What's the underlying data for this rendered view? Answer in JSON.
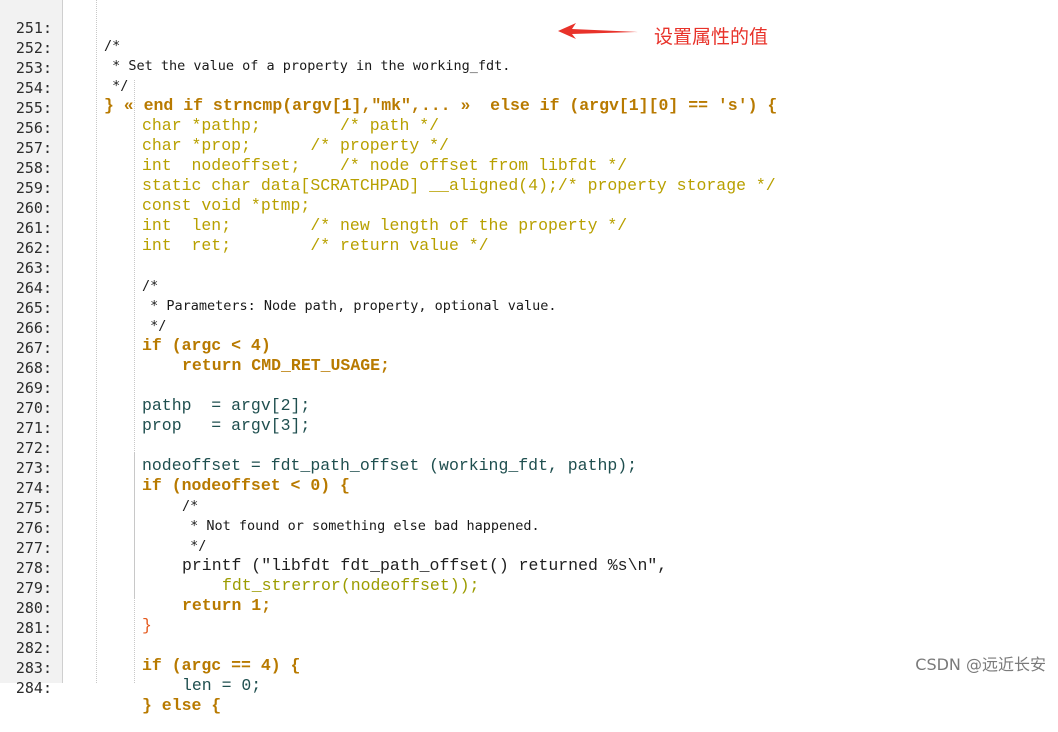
{
  "annotation": {
    "text": "设置属性的值",
    "arrow_icon": "red-arrow-icon",
    "color": "#e8322a"
  },
  "watermark": "CSDN @远近长安",
  "lines": [
    {
      "n": "251:",
      "t": "/*"
    },
    {
      "n": "252:",
      "t": " * Set the value of a property in the working_fdt."
    },
    {
      "n": "253:",
      "t": " */"
    },
    {
      "n": "254:",
      "t": "} « end if strncmp(argv[1],\"mk\",... »  else if (argv[1][0] == 's') {"
    },
    {
      "n": "255:",
      "t": "char *pathp;        /* path */"
    },
    {
      "n": "256:",
      "t": "char *prop;      /* property */"
    },
    {
      "n": "257:",
      "t": "int  nodeoffset;    /* node offset from libfdt */"
    },
    {
      "n": "258:",
      "t": "static char data[SCRATCHPAD] __aligned(4);/* property storage */"
    },
    {
      "n": "259:",
      "t": "const void *ptmp;"
    },
    {
      "n": "260:",
      "t": "int  len;        /* new length of the property */"
    },
    {
      "n": "261:",
      "t": "int  ret;        /* return value */"
    },
    {
      "n": "262:",
      "t": ""
    },
    {
      "n": "263:",
      "t": "/*"
    },
    {
      "n": "264:",
      "t": " * Parameters: Node path, property, optional value."
    },
    {
      "n": "265:",
      "t": " */"
    },
    {
      "n": "266:",
      "t": "if (argc < 4)"
    },
    {
      "n": "267:",
      "t": "return CMD_RET_USAGE;"
    },
    {
      "n": "268:",
      "t": ""
    },
    {
      "n": "269:",
      "t": "pathp  = argv[2];"
    },
    {
      "n": "270:",
      "t": "prop   = argv[3];"
    },
    {
      "n": "271:",
      "t": ""
    },
    {
      "n": "272:",
      "t": "nodeoffset = fdt_path_offset (working_fdt, pathp);"
    },
    {
      "n": "273:",
      "t": "if (nodeoffset < 0) {"
    },
    {
      "n": "274:",
      "t": "/*"
    },
    {
      "n": "275:",
      "t": " * Not found or something else bad happened."
    },
    {
      "n": "276:",
      "t": " */"
    },
    {
      "n": "277:",
      "t": "printf (\"libfdt fdt_path_offset() returned %s\\n\","
    },
    {
      "n": "278:",
      "t": "fdt_strerror(nodeoffset));"
    },
    {
      "n": "279:",
      "t": "return 1;"
    },
    {
      "n": "280:",
      "t": "}"
    },
    {
      "n": "281:",
      "t": ""
    },
    {
      "n": "282:",
      "t": "if (argc == 4) {"
    },
    {
      "n": "283:",
      "t": "len = 0;"
    },
    {
      "n": "284:",
      "t": "} else {"
    }
  ]
}
